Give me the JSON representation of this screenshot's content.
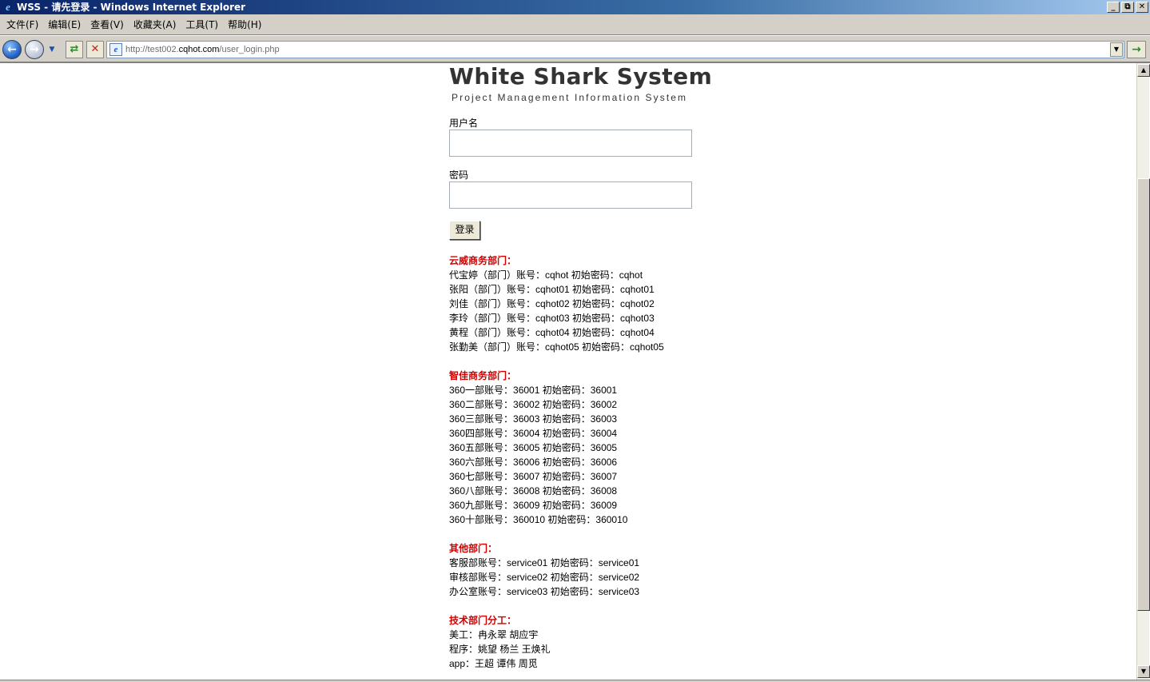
{
  "window": {
    "title": "WSS - 请先登录 - Windows Internet Explorer",
    "app_icon": "ie-icon",
    "buttons": [
      "_",
      "⧉",
      "✕"
    ]
  },
  "menu": {
    "items": [
      "文件(F)",
      "编辑(E)",
      "查看(V)",
      "收藏夹(A)",
      "工具(T)",
      "帮助(H)"
    ]
  },
  "navbar": {
    "url_prefix": "http://test002.",
    "url_host": "cqhot.com",
    "url_path": "/user_login.php"
  },
  "login": {
    "logo_title": "White Shark System",
    "logo_subtitle": "Project Management Information System",
    "username_label": "用户名",
    "username_value": "",
    "password_label": "密码",
    "password_value": "",
    "submit_label": "登录"
  },
  "sections": [
    {
      "title": "云威商务部门：",
      "lines": [
        "代宝婷（部门）账号：cqhot 初始密码：cqhot",
        "张阳（部门）账号：cqhot01 初始密码：cqhot01",
        "刘佳（部门）账号：cqhot02 初始密码：cqhot02",
        "李玲（部门）账号：cqhot03 初始密码：cqhot03",
        "黄程（部门）账号：cqhot04 初始密码：cqhot04",
        "张勤美（部门）账号：cqhot05 初始密码：cqhot05"
      ]
    },
    {
      "title": "智佳商务部门：",
      "lines": [
        "360一部账号：36001 初始密码：36001",
        "360二部账号：36002 初始密码：36002",
        "360三部账号：36003 初始密码：36003",
        "360四部账号：36004 初始密码：36004",
        "360五部账号：36005 初始密码：36005",
        "360六部账号：36006 初始密码：36006",
        "360七部账号：36007 初始密码：36007",
        "360八部账号：36008 初始密码：36008",
        "360九部账号：36009 初始密码：36009",
        "360十部账号：360010 初始密码：360010"
      ]
    },
    {
      "title": "其他部门：",
      "lines": [
        "客服部账号：service01 初始密码：service01",
        "审核部账号：service02 初始密码：service02",
        "办公室账号：service03 初始密码：service03"
      ]
    },
    {
      "title": "技术部门分工：",
      "lines": [
        "美工：冉永翠 胡应宇",
        "程序：姚望 杨兰 王焕礼",
        "app：王超 谭伟 周觅"
      ]
    }
  ]
}
